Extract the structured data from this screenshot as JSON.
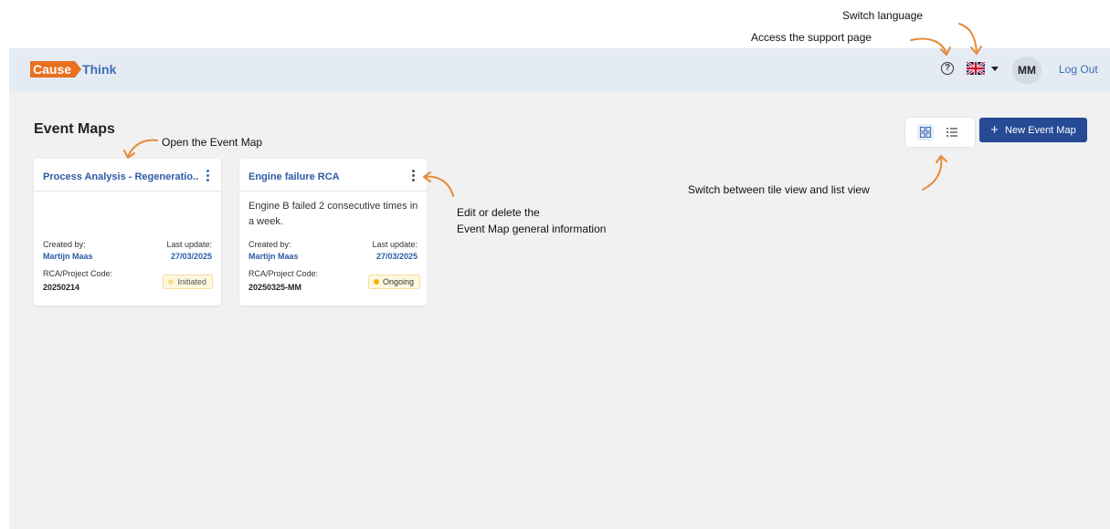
{
  "annotations": {
    "switch_language": "Switch language",
    "support_page": "Access the support page",
    "open_event_map": "Open the Event Map",
    "edit_delete_line1": "Edit or delete the",
    "edit_delete_line2": "Event Map general information",
    "switch_view": "Switch between tile view and list view",
    "arrow_color": "#e88a3a"
  },
  "header": {
    "logo_left": "Cause",
    "logo_right": "Think",
    "logo_colors": {
      "cause_bg": "#e8701f",
      "think_text": "#3b6fb6"
    },
    "help_icon": "?",
    "language_icon": "uk-flag-icon",
    "user_initials": "MM",
    "logout_label": "Log Out"
  },
  "main": {
    "title": "Event Maps",
    "view_toggle": {
      "active": "tile",
      "icons": [
        "grid-icon",
        "list-icon"
      ]
    },
    "new_button_label": "New Event Map",
    "new_button_color": "#264a94"
  },
  "cards": [
    {
      "title": "Process Analysis - Regeneratio...",
      "description": "",
      "created_by_label": "Created by:",
      "created_by": "Martijn Maas",
      "last_update_label": "Last update:",
      "last_update": "27/03/2025",
      "code_label": "RCA/Project Code:",
      "code": "20250214",
      "status": "Initiated"
    },
    {
      "title": "Engine failure RCA",
      "description": "Engine B failed 2 consecutive times in a week.",
      "created_by_label": "Created by:",
      "created_by": "Martijn Maas",
      "last_update_label": "Last update:",
      "last_update": "27/03/2025",
      "code_label": "RCA/Project Code:",
      "code": "20250325-MM",
      "status": "Ongoing"
    }
  ]
}
